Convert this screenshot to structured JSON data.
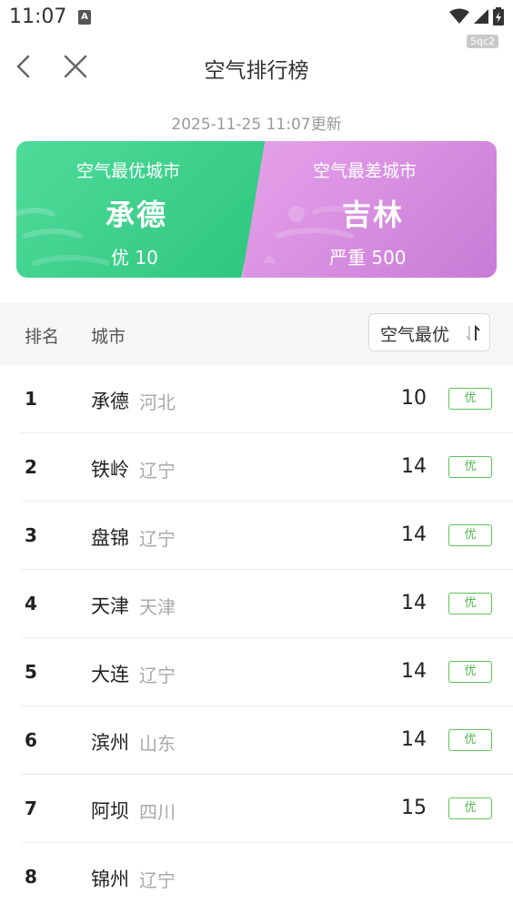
{
  "status_bar": {
    "time": "11:07",
    "icons": [
      "a-notification-icon",
      "wifi-icon",
      "signal-icon",
      "battery-icon"
    ]
  },
  "watermark": "5qc2",
  "nav": {
    "title": "空气排行榜",
    "icons": [
      "back-icon",
      "close-icon"
    ]
  },
  "update_time": "2025-11-25 11:07更新",
  "best_card": {
    "label": "空气最优城市",
    "city": "承德",
    "value": "优 10",
    "color": "#2ec67e"
  },
  "worst_card": {
    "label": "空气最差城市",
    "city": "吉林",
    "value": "严重 500",
    "color": "#c87bd6"
  },
  "table": {
    "header_rank": "排名",
    "header_city": "城市",
    "sort_label": "空气最优",
    "sort_icon": "sort-arrows-icon",
    "rows": [
      {
        "rank": "1",
        "city": "承德",
        "province": "河北",
        "aqi": "10",
        "level": "优"
      },
      {
        "rank": "2",
        "city": "铁岭",
        "province": "辽宁",
        "aqi": "14",
        "level": "优"
      },
      {
        "rank": "3",
        "city": "盘锦",
        "province": "辽宁",
        "aqi": "14",
        "level": "优"
      },
      {
        "rank": "4",
        "city": "天津",
        "province": "天津",
        "aqi": "14",
        "level": "优"
      },
      {
        "rank": "5",
        "city": "大连",
        "province": "辽宁",
        "aqi": "14",
        "level": "优"
      },
      {
        "rank": "6",
        "city": "滨州",
        "province": "山东",
        "aqi": "14",
        "level": "优"
      },
      {
        "rank": "7",
        "city": "阿坝",
        "province": "四川",
        "aqi": "15",
        "level": "优"
      },
      {
        "rank": "8",
        "city": "锦州",
        "province": "辽宁",
        "aqi": "",
        "level": ""
      }
    ]
  },
  "colors": {
    "level_good": "#4fb84f",
    "header_bg": "#f6f6f6"
  }
}
